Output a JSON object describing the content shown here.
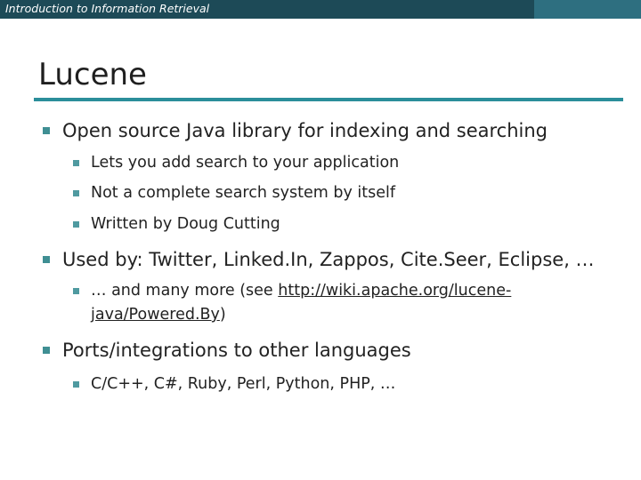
{
  "header": {
    "course_title": "Introduction to Information Retrieval"
  },
  "slide": {
    "title": "Lucene",
    "bullets": [
      {
        "text": "Open source Java library for indexing and searching",
        "sub": [
          "Lets you add search to your application",
          "Not a complete search system by itself",
          "Written by Doug Cutting"
        ]
      },
      {
        "text": "Used by: Twitter, Linked.In, Zappos, Cite.Seer, Eclipse, …",
        "sub_link": {
          "prefix": "… and many more (see ",
          "url_line1": "http://wiki.apache.org/lucene-",
          "url_line2": "java/Powered.By",
          "suffix": ")"
        }
      },
      {
        "text": "Ports/integrations to other languages",
        "sub": [
          "C/C++, C#, Ruby, Perl, Python, PHP, …"
        ]
      }
    ]
  },
  "colors": {
    "header_bar": "#1d4a57",
    "accent_rule": "#2b8e9a",
    "bullet": "#3f8f93"
  }
}
